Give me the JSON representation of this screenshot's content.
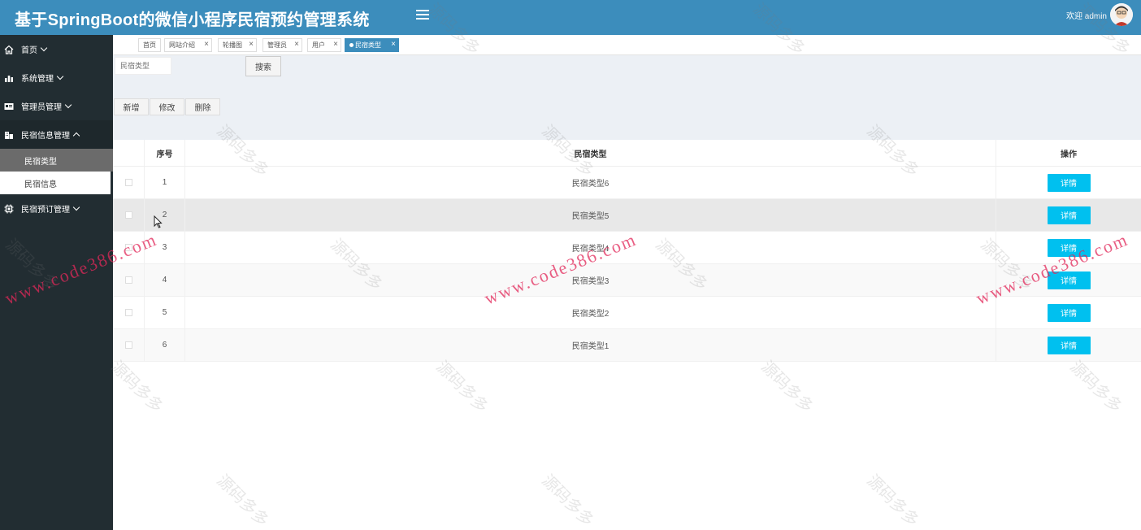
{
  "header": {
    "title": "基于SpringBoot的微信小程序民宿预约管理系统",
    "welcome": "欢迎 admin",
    "bg_color": "#3c8dbc"
  },
  "sidebar": {
    "items": [
      {
        "label": "首页",
        "icon": "home-icon"
      },
      {
        "label": "系统管理",
        "icon": "bar-chart-icon"
      },
      {
        "label": "管理员管理",
        "icon": "id-card-icon"
      },
      {
        "label": "民宿信息管理",
        "icon": "building-icon",
        "expanded": true,
        "children": [
          {
            "label": "民宿类型",
            "selected": true
          },
          {
            "label": "民宿信息"
          }
        ]
      },
      {
        "label": "民宿预订管理",
        "icon": "chip-icon"
      }
    ]
  },
  "tabs": [
    {
      "label": "首页"
    },
    {
      "label": "网站介绍"
    },
    {
      "label": "轮播图"
    },
    {
      "label": "管理员"
    },
    {
      "label": "用户"
    },
    {
      "label": "民宿类型",
      "active": true
    }
  ],
  "filters": {
    "type_placeholder": "民宿类型",
    "search_label": "搜索"
  },
  "actions": {
    "add": "新增",
    "edit": "修改",
    "delete": "删除"
  },
  "table": {
    "headers": {
      "index": "序号",
      "type": "民宿类型",
      "op": "操作"
    },
    "rows": [
      {
        "index": "1",
        "type": "民宿类型6",
        "op": "详情"
      },
      {
        "index": "2",
        "type": "民宿类型5",
        "op": "详情"
      },
      {
        "index": "3",
        "type": "民宿类型4",
        "op": "详情"
      },
      {
        "index": "4",
        "type": "民宿类型3",
        "op": "详情"
      },
      {
        "index": "5",
        "type": "民宿类型2",
        "op": "详情"
      },
      {
        "index": "6",
        "type": "民宿类型1",
        "op": "详情"
      }
    ]
  },
  "watermark": {
    "text": "源码多多",
    "url": "www.code386.com"
  }
}
